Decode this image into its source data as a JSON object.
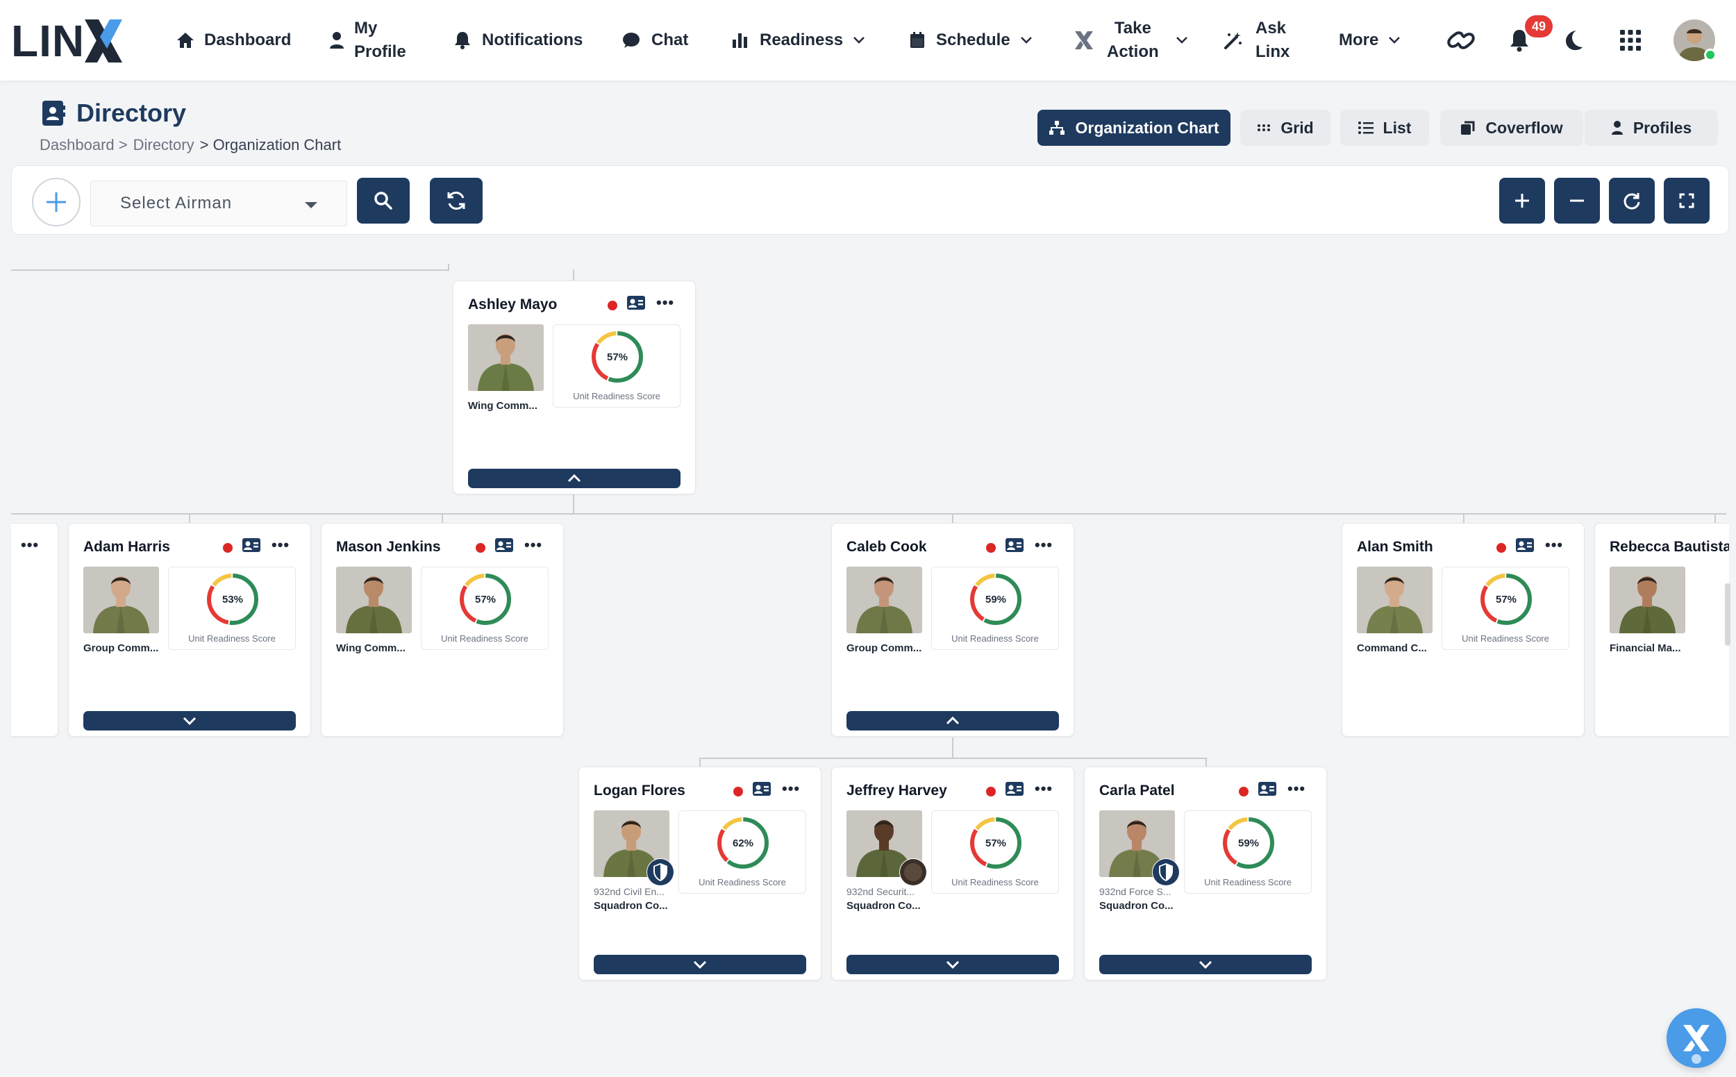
{
  "app": {
    "logo_text": "LIN"
  },
  "nav": {
    "dashboard": "Dashboard",
    "my_profile_1": "My",
    "my_profile_2": "Profile",
    "notifications": "Notifications",
    "chat": "Chat",
    "readiness": "Readiness",
    "schedule": "Schedule",
    "take_action_1": "Take",
    "take_action_2": "Action",
    "ask_linx_1": "Ask",
    "ask_linx_2": "Linx",
    "more": "More",
    "notif_count": "49"
  },
  "page": {
    "title": "Directory",
    "breadcrumb": [
      "Dashboard >",
      "Directory",
      "> Organization Chart"
    ]
  },
  "view_tabs": [
    "Organization Chart",
    "Grid",
    "List",
    "Coverflow",
    "Profiles"
  ],
  "toolbar": {
    "select_placeholder": "Select Airman"
  },
  "org": {
    "score_label": "Unit Readiness Score",
    "people": [
      {
        "name": "Ashley Mayo",
        "role": "Wing Comm...",
        "score": 57
      },
      {
        "name": "Adam Harris",
        "role": "Group Comm...",
        "score": 53
      },
      {
        "name": "Mason Jenkins",
        "role": "Wing Comm...",
        "score": 57
      },
      {
        "name": "Caleb Cook",
        "role": "Group Comm...",
        "score": 59
      },
      {
        "name": "Alan Smith",
        "role": "Command C...",
        "score": 57
      },
      {
        "name": "Rebecca Bautista",
        "role": "Financial Ma..."
      },
      {
        "name": "Logan Flores",
        "unit": "932nd Civil En...",
        "role": "Squadron Co...",
        "score": 62
      },
      {
        "name": "Jeffrey Harvey",
        "unit": "932nd Securit...",
        "role": "Squadron Co...",
        "score": 57
      },
      {
        "name": "Carla Patel",
        "unit": "932nd Force S...",
        "role": "Squadron Co...",
        "score": 59
      }
    ]
  },
  "colors": {
    "primary": "#1e3a5f",
    "accent": "#4a9be8",
    "status_red": "#dc2626",
    "ring_green": "#2e8b57",
    "ring_red": "#e53935",
    "ring_yellow": "#f4c542"
  },
  "icons": [
    "home-icon",
    "user-icon",
    "bell-icon",
    "chat-icon",
    "bar-chart-icon",
    "calendar-icon",
    "linx-x-icon",
    "magic-wand-icon",
    "chevron-down-icon",
    "link-icon",
    "moon-icon",
    "apps-grid-icon",
    "contact-card-icon",
    "sitemap-icon",
    "list-icon",
    "coverflow-icon",
    "plus-icon",
    "search-icon",
    "refresh-icon",
    "minus-icon",
    "rotate-icon",
    "fullscreen-icon",
    "ellipsis-icon",
    "chevron-up-icon",
    "shield-icon"
  ]
}
